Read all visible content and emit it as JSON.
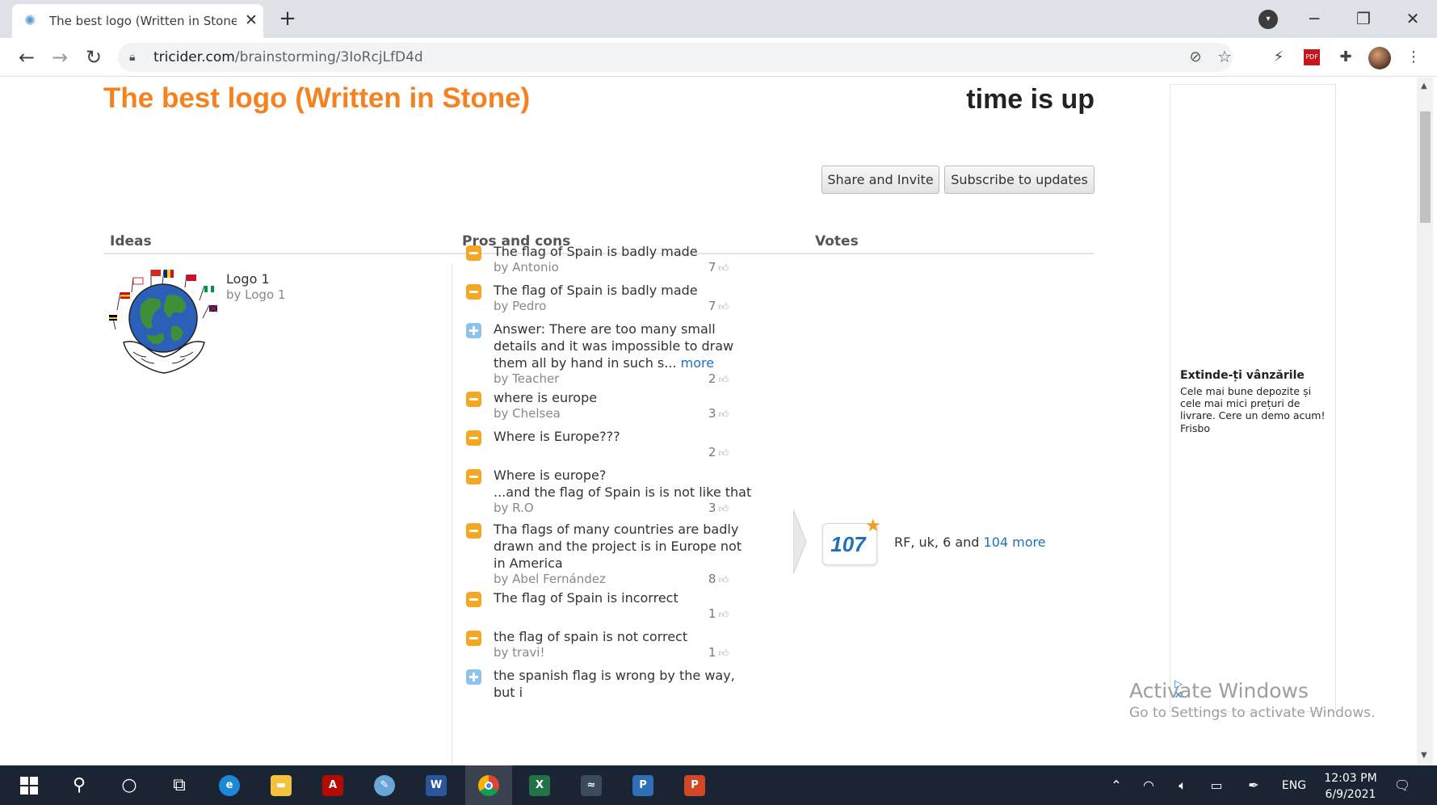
{
  "browser": {
    "tab_title": "The best logo (Written in Stone)",
    "tab_close": "✕",
    "new_tab": "+",
    "url_host": "tricider.com",
    "url_path": "/brainstorming/3IoRcjLfD4d",
    "window_minimize": "─",
    "window_restore": "❐",
    "window_close": "✕"
  },
  "page": {
    "title": "The best logo (Written in Stone)",
    "status": "time is up",
    "buttons": {
      "share": "Share and Invite",
      "subscribe": "Subscribe to updates"
    },
    "columns": {
      "ideas": "Ideas",
      "pros_cons": "Pros and cons",
      "votes": "Votes"
    }
  },
  "idea": {
    "name": "Logo 1",
    "by": "by Logo 1"
  },
  "arguments": [
    {
      "kind": "con",
      "text": "The flag of Spain is badly made",
      "by": "by Antonio",
      "count": "7"
    },
    {
      "kind": "con",
      "text": "The flag of Spain is badly made",
      "by": "by Pedro",
      "count": "7"
    },
    {
      "kind": "pro",
      "text": "Answer: There are too many small details and it was impossible to draw them all by hand in such s...",
      "more": "more",
      "by": "by Teacher",
      "count": "2"
    },
    {
      "kind": "con",
      "text": "where is europe",
      "by": "by Chelsea",
      "count": "3"
    },
    {
      "kind": "con",
      "text": "Where is Europe???",
      "by": "",
      "count": "2"
    },
    {
      "kind": "con",
      "text": "Where is europe?\n...and the flag of Spain is is not like that",
      "by": "by R.O",
      "count": "3"
    },
    {
      "kind": "con",
      "text": "Tha flags of many countries are badly drawn and the project is in Europe not in America",
      "by": "by Abel Fernández",
      "count": "8"
    },
    {
      "kind": "con",
      "text": "The flag of Spain is incorrect",
      "by": "",
      "count": "1"
    },
    {
      "kind": "con",
      "text": "the flag of spain is not correct",
      "by": "by travi!",
      "count": "1"
    },
    {
      "kind": "pro",
      "text": "the spanish flag is wrong by the way, but i",
      "by": "",
      "count": ""
    }
  ],
  "votes": {
    "count": "107",
    "voters": "RF, uk, 6 and",
    "more_link": "104 more"
  },
  "ad": {
    "title": "Extinde-ți vânzările",
    "description": "Cele mai bune depozite și cele mai mici prețuri de livrare. Cere un demo acum!",
    "brand": "Frisbo"
  },
  "watermark": {
    "line1": "Activate Windows",
    "line2": "Go to Settings to activate Windows."
  },
  "taskbar": {
    "language": "ENG",
    "time": "12:03 PM",
    "date": "6/9/2021"
  },
  "colors": {
    "accent": "#f58220",
    "link": "#1f6fbf",
    "con": "#f5a623",
    "pro": "#8cc4ec"
  }
}
